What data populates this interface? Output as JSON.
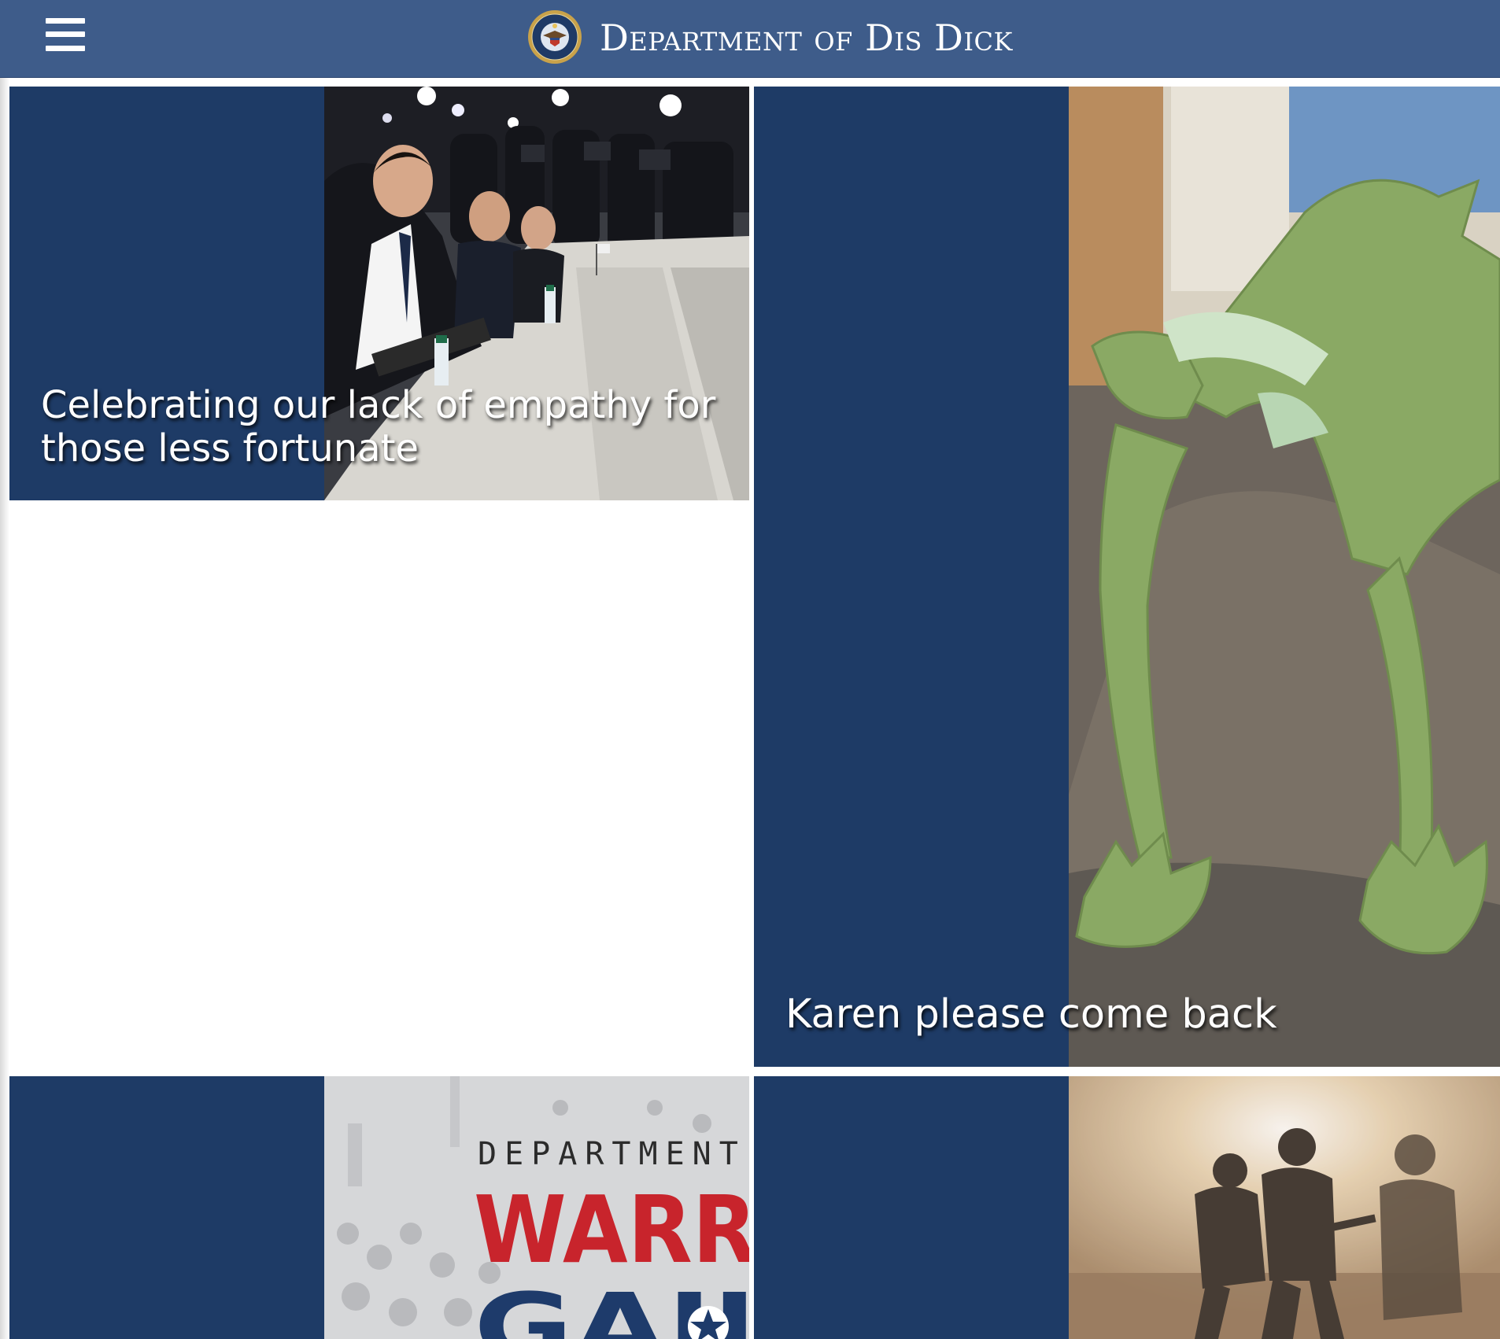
{
  "header": {
    "title": "Department of Dis Dick",
    "menu_icon": "hamburger-menu-icon",
    "seal_icon": "department-seal-icon",
    "background_color": "#3e5c8a"
  },
  "cards": [
    {
      "caption": "Celebrating our lack of empathy for those less fortunate",
      "image": "press-conference-photo"
    },
    {
      "caption": "Karen please come back",
      "image": "green-frog-puppet-photo"
    },
    {
      "caption": "",
      "image": "department-of-war-poster",
      "poster_text": [
        "DEPARTMENT OF",
        "WARR",
        "GAII"
      ]
    },
    {
      "caption": "",
      "image": "soldiers-in-dust-photo"
    }
  ],
  "card_panel_color": "#1e3b66"
}
